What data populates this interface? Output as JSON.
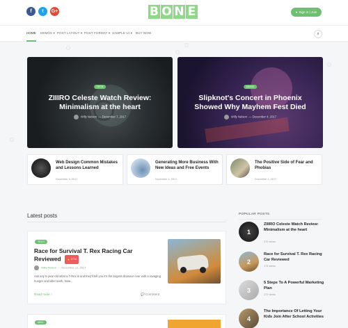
{
  "header": {
    "social": [
      {
        "name": "facebook",
        "glyph": "f",
        "color": "#3b5998"
      },
      {
        "name": "twitter",
        "glyph": "t",
        "color": "#1da1f2"
      },
      {
        "name": "google-plus",
        "glyph": "G+",
        "color": "#dd4b39"
      }
    ],
    "logo_letters": [
      "B",
      "O",
      "N",
      "E"
    ],
    "signin_label": "Sign in | Join"
  },
  "nav": {
    "items": [
      "HOME",
      "DEMOS ▾",
      "POST LAYOUT ▾",
      "POST FORMAT ▾",
      "SAMPLE UI ▾",
      "BUY NOW"
    ]
  },
  "hero": [
    {
      "tag": "TECH",
      "title": "ZIIIRO Celeste Watch Review: Minimalism at the heart",
      "author": "Willy Nelson",
      "date": "December 7, 2017"
    },
    {
      "tag": "MUSIC",
      "title": "Slipknot's Concert in Phoenix Showed Why Mayhem Fest Died",
      "author": "Willy Nelson",
      "date": "December 4, 2017"
    }
  ],
  "cards": [
    {
      "title": "Web Design Common Mistakes and Lessons Learned",
      "date": "December 3, 2017"
    },
    {
      "title": "Generating More Business With New Ideas and Free Events",
      "date": "November 1, 2017"
    },
    {
      "title": "The Positive Side of Fear and Phobias",
      "date": "December 1, 2017"
    }
  ],
  "latest": {
    "section_title": "Latest posts",
    "post": {
      "tag": "TECH",
      "title": "Race for Survival T. Rex Racing Car Reviewed",
      "hot_label": "🔥 2710",
      "author": "Willy Nelson",
      "date": "December 12, 2017",
      "excerpt": "Ask any 5-year-old what a T-Rex is and they'll tell you it's the largest dinosaur ever with a ravaging hunger and killer teeth. Now...",
      "read_more": "Read more ›",
      "comment": "💬 Comment"
    },
    "post2_tag": "MISC"
  },
  "popular": {
    "title": "POPULAR POSTS",
    "items": [
      {
        "num": "1",
        "title": "ZIIIRO Celeste Watch Review: Minimalism at the heart",
        "views": "270 views"
      },
      {
        "num": "2",
        "title": "Race for Survival T. Rex Racing Car Reviewed",
        "views": "174 views"
      },
      {
        "num": "3",
        "title": "5 Steps To A Powerful Marketing Plan",
        "views": "172 views"
      },
      {
        "num": "4",
        "title": "The Importance Of Letting Your Kids Join After School Activities",
        "views": ""
      }
    ]
  },
  "colors": {
    "accent": "#6cc070",
    "hot": "#f05a5a"
  }
}
